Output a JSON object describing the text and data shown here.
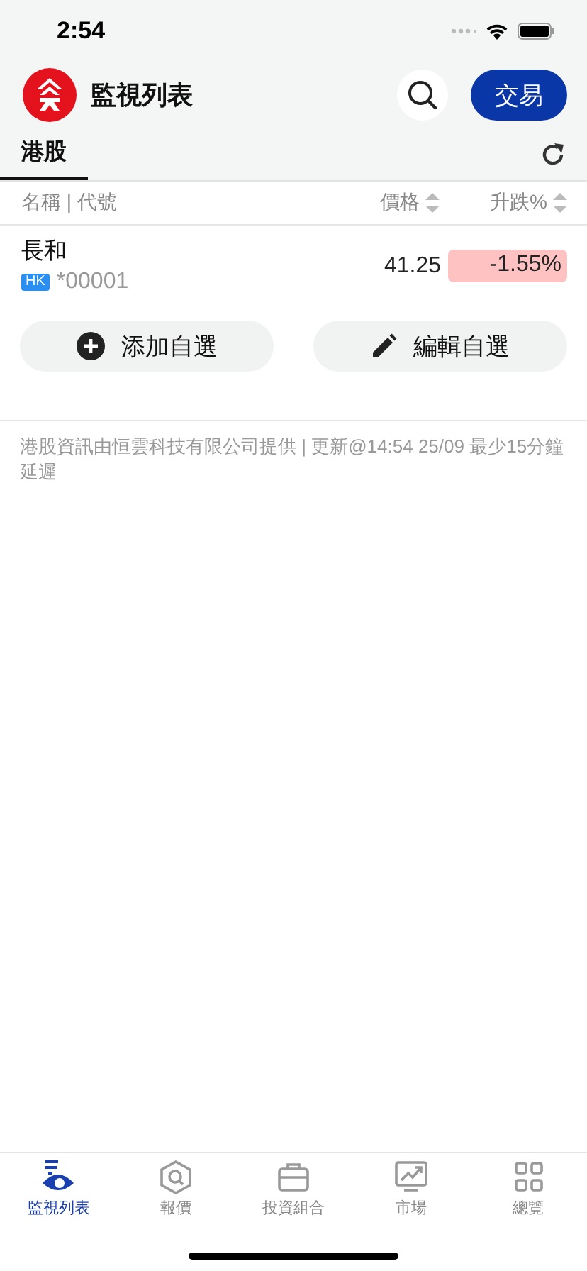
{
  "status_bar": {
    "time": "2:54"
  },
  "header": {
    "title": "監視列表",
    "trade_button": "交易"
  },
  "tabs": [
    {
      "label": "港股",
      "selected": true
    }
  ],
  "table": {
    "columns": [
      {
        "label": "名稱 | 代號",
        "sortable": false
      },
      {
        "label": "價格",
        "sortable": true
      },
      {
        "label": "升跌%",
        "sortable": true
      }
    ],
    "rows": [
      {
        "name": "長和",
        "market": "HK",
        "code": "*00001",
        "price": "41.25",
        "change": "-1.55%",
        "kind": "down"
      }
    ]
  },
  "actions": [
    {
      "kind": "add",
      "label": "添加自選"
    },
    {
      "kind": "edit",
      "label": "編輯自選"
    }
  ],
  "footnote": "港股資訊由恒雲科技有限公司提供 | 更新@14:54 25/09 最少15分鐘延遲",
  "bottom_nav": [
    {
      "kind": "watchlist",
      "label": "監視列表",
      "selected": true
    },
    {
      "kind": "quote",
      "label": "報價",
      "selected": false
    },
    {
      "kind": "portfolio",
      "label": "投資組合",
      "selected": false
    },
    {
      "kind": "market",
      "label": "市場",
      "selected": false
    },
    {
      "kind": "overview",
      "label": "總覽",
      "selected": false
    }
  ]
}
